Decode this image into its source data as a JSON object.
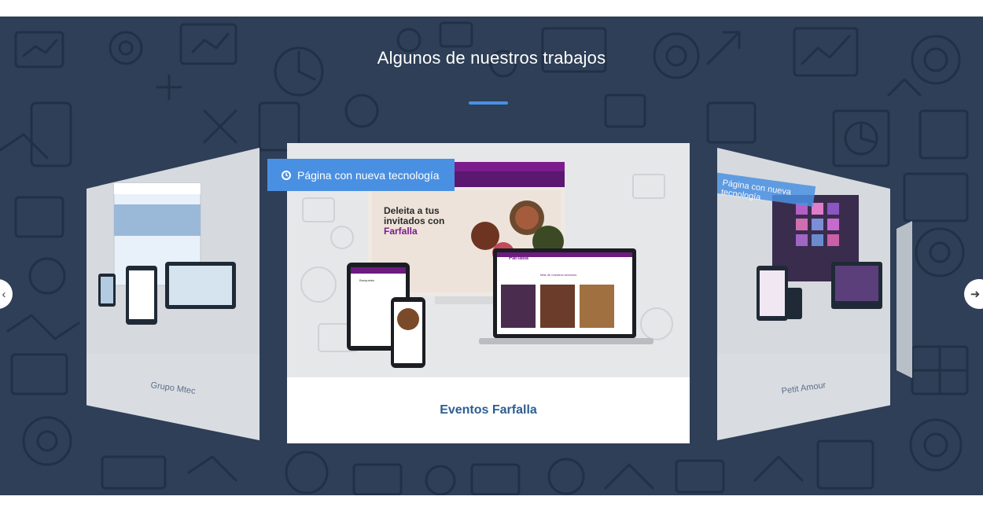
{
  "section": {
    "title": "Algunos de nuestros trabajos",
    "colors": {
      "background": "#2e3f57",
      "accent": "#4a90e2",
      "title_link": "#2d5e93"
    }
  },
  "carousel": {
    "prev_icon": "chevron-left-icon",
    "next_icon": "arrow-right-icon",
    "items": [
      {
        "label": "Grupo Mtec",
        "badge": ""
      },
      {
        "label": "Eventos Farfalla",
        "badge": "Página con nueva tecnología",
        "badge_icon": "clock-icon",
        "preview": {
          "headline_1": "Deleita a tus",
          "headline_2": "invitados con",
          "brand": "Farfalla",
          "brand_logo": "Farfalla",
          "section_heading": "Más de nuestros servicios",
          "phone_heading": "Banquetes"
        }
      },
      {
        "label": "Petit Amour",
        "badge": "Página con nueva tecnología"
      }
    ]
  }
}
